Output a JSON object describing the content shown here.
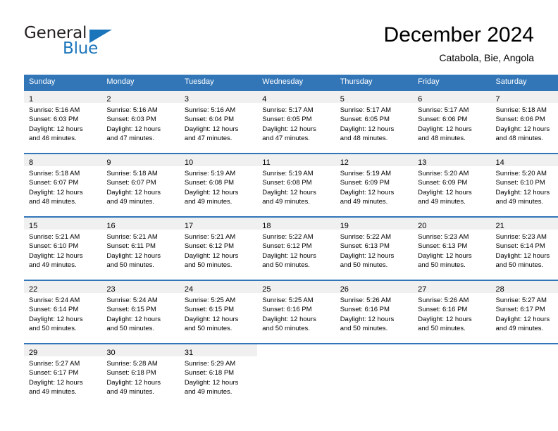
{
  "logo": {
    "word_top": "General",
    "word_bottom": "Blue",
    "accent_color": "#1b75bb",
    "triangle_icon": "triangle-icon"
  },
  "header": {
    "title": "December 2024",
    "subtitle": "Catabola, Bie, Angola"
  },
  "theme": {
    "header_bg": "#3276b8",
    "daynum_band_bg": "#f0f0f0",
    "text": "#000000",
    "page_bg": "#ffffff"
  },
  "calendar": {
    "weekday_headers": [
      "Sunday",
      "Monday",
      "Tuesday",
      "Wednesday",
      "Thursday",
      "Friday",
      "Saturday"
    ],
    "weeks": [
      [
        {
          "day": "1",
          "sunrise": "Sunrise: 5:16 AM",
          "sunset": "Sunset: 6:03 PM",
          "daylight1": "Daylight: 12 hours",
          "daylight2": "and 46 minutes."
        },
        {
          "day": "2",
          "sunrise": "Sunrise: 5:16 AM",
          "sunset": "Sunset: 6:03 PM",
          "daylight1": "Daylight: 12 hours",
          "daylight2": "and 47 minutes."
        },
        {
          "day": "3",
          "sunrise": "Sunrise: 5:16 AM",
          "sunset": "Sunset: 6:04 PM",
          "daylight1": "Daylight: 12 hours",
          "daylight2": "and 47 minutes."
        },
        {
          "day": "4",
          "sunrise": "Sunrise: 5:17 AM",
          "sunset": "Sunset: 6:05 PM",
          "daylight1": "Daylight: 12 hours",
          "daylight2": "and 47 minutes."
        },
        {
          "day": "5",
          "sunrise": "Sunrise: 5:17 AM",
          "sunset": "Sunset: 6:05 PM",
          "daylight1": "Daylight: 12 hours",
          "daylight2": "and 48 minutes."
        },
        {
          "day": "6",
          "sunrise": "Sunrise: 5:17 AM",
          "sunset": "Sunset: 6:06 PM",
          "daylight1": "Daylight: 12 hours",
          "daylight2": "and 48 minutes."
        },
        {
          "day": "7",
          "sunrise": "Sunrise: 5:18 AM",
          "sunset": "Sunset: 6:06 PM",
          "daylight1": "Daylight: 12 hours",
          "daylight2": "and 48 minutes."
        }
      ],
      [
        {
          "day": "8",
          "sunrise": "Sunrise: 5:18 AM",
          "sunset": "Sunset: 6:07 PM",
          "daylight1": "Daylight: 12 hours",
          "daylight2": "and 48 minutes."
        },
        {
          "day": "9",
          "sunrise": "Sunrise: 5:18 AM",
          "sunset": "Sunset: 6:07 PM",
          "daylight1": "Daylight: 12 hours",
          "daylight2": "and 49 minutes."
        },
        {
          "day": "10",
          "sunrise": "Sunrise: 5:19 AM",
          "sunset": "Sunset: 6:08 PM",
          "daylight1": "Daylight: 12 hours",
          "daylight2": "and 49 minutes."
        },
        {
          "day": "11",
          "sunrise": "Sunrise: 5:19 AM",
          "sunset": "Sunset: 6:08 PM",
          "daylight1": "Daylight: 12 hours",
          "daylight2": "and 49 minutes."
        },
        {
          "day": "12",
          "sunrise": "Sunrise: 5:19 AM",
          "sunset": "Sunset: 6:09 PM",
          "daylight1": "Daylight: 12 hours",
          "daylight2": "and 49 minutes."
        },
        {
          "day": "13",
          "sunrise": "Sunrise: 5:20 AM",
          "sunset": "Sunset: 6:09 PM",
          "daylight1": "Daylight: 12 hours",
          "daylight2": "and 49 minutes."
        },
        {
          "day": "14",
          "sunrise": "Sunrise: 5:20 AM",
          "sunset": "Sunset: 6:10 PM",
          "daylight1": "Daylight: 12 hours",
          "daylight2": "and 49 minutes."
        }
      ],
      [
        {
          "day": "15",
          "sunrise": "Sunrise: 5:21 AM",
          "sunset": "Sunset: 6:10 PM",
          "daylight1": "Daylight: 12 hours",
          "daylight2": "and 49 minutes."
        },
        {
          "day": "16",
          "sunrise": "Sunrise: 5:21 AM",
          "sunset": "Sunset: 6:11 PM",
          "daylight1": "Daylight: 12 hours",
          "daylight2": "and 50 minutes."
        },
        {
          "day": "17",
          "sunrise": "Sunrise: 5:21 AM",
          "sunset": "Sunset: 6:12 PM",
          "daylight1": "Daylight: 12 hours",
          "daylight2": "and 50 minutes."
        },
        {
          "day": "18",
          "sunrise": "Sunrise: 5:22 AM",
          "sunset": "Sunset: 6:12 PM",
          "daylight1": "Daylight: 12 hours",
          "daylight2": "and 50 minutes."
        },
        {
          "day": "19",
          "sunrise": "Sunrise: 5:22 AM",
          "sunset": "Sunset: 6:13 PM",
          "daylight1": "Daylight: 12 hours",
          "daylight2": "and 50 minutes."
        },
        {
          "day": "20",
          "sunrise": "Sunrise: 5:23 AM",
          "sunset": "Sunset: 6:13 PM",
          "daylight1": "Daylight: 12 hours",
          "daylight2": "and 50 minutes."
        },
        {
          "day": "21",
          "sunrise": "Sunrise: 5:23 AM",
          "sunset": "Sunset: 6:14 PM",
          "daylight1": "Daylight: 12 hours",
          "daylight2": "and 50 minutes."
        }
      ],
      [
        {
          "day": "22",
          "sunrise": "Sunrise: 5:24 AM",
          "sunset": "Sunset: 6:14 PM",
          "daylight1": "Daylight: 12 hours",
          "daylight2": "and 50 minutes."
        },
        {
          "day": "23",
          "sunrise": "Sunrise: 5:24 AM",
          "sunset": "Sunset: 6:15 PM",
          "daylight1": "Daylight: 12 hours",
          "daylight2": "and 50 minutes."
        },
        {
          "day": "24",
          "sunrise": "Sunrise: 5:25 AM",
          "sunset": "Sunset: 6:15 PM",
          "daylight1": "Daylight: 12 hours",
          "daylight2": "and 50 minutes."
        },
        {
          "day": "25",
          "sunrise": "Sunrise: 5:25 AM",
          "sunset": "Sunset: 6:16 PM",
          "daylight1": "Daylight: 12 hours",
          "daylight2": "and 50 minutes."
        },
        {
          "day": "26",
          "sunrise": "Sunrise: 5:26 AM",
          "sunset": "Sunset: 6:16 PM",
          "daylight1": "Daylight: 12 hours",
          "daylight2": "and 50 minutes."
        },
        {
          "day": "27",
          "sunrise": "Sunrise: 5:26 AM",
          "sunset": "Sunset: 6:16 PM",
          "daylight1": "Daylight: 12 hours",
          "daylight2": "and 50 minutes."
        },
        {
          "day": "28",
          "sunrise": "Sunrise: 5:27 AM",
          "sunset": "Sunset: 6:17 PM",
          "daylight1": "Daylight: 12 hours",
          "daylight2": "and 49 minutes."
        }
      ],
      [
        {
          "day": "29",
          "sunrise": "Sunrise: 5:27 AM",
          "sunset": "Sunset: 6:17 PM",
          "daylight1": "Daylight: 12 hours",
          "daylight2": "and 49 minutes."
        },
        {
          "day": "30",
          "sunrise": "Sunrise: 5:28 AM",
          "sunset": "Sunset: 6:18 PM",
          "daylight1": "Daylight: 12 hours",
          "daylight2": "and 49 minutes."
        },
        {
          "day": "31",
          "sunrise": "Sunrise: 5:29 AM",
          "sunset": "Sunset: 6:18 PM",
          "daylight1": "Daylight: 12 hours",
          "daylight2": "and 49 minutes."
        },
        null,
        null,
        null,
        null
      ]
    ]
  }
}
